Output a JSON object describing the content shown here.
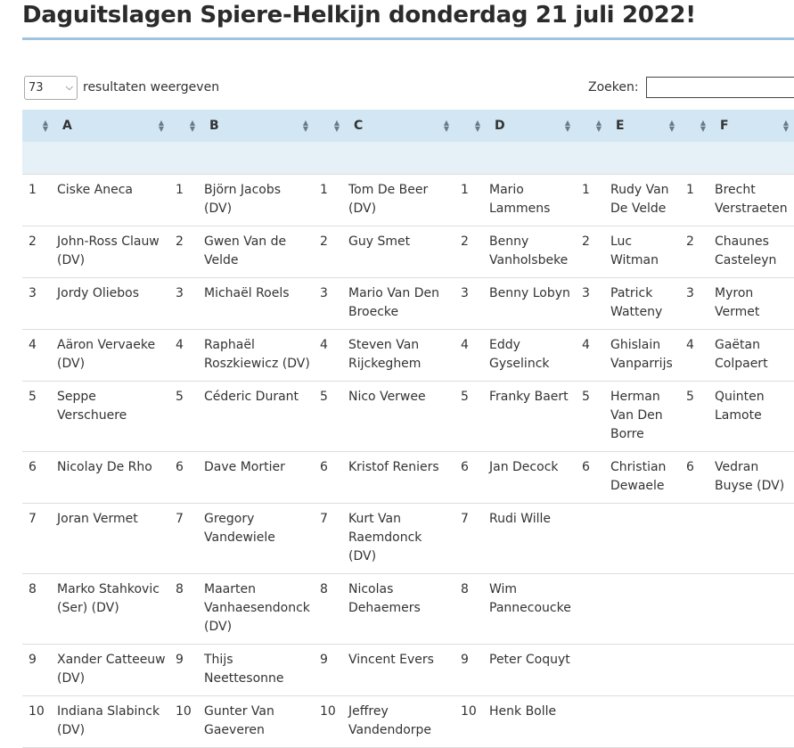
{
  "page": {
    "title": "Daguitslagen Spiere-Helkijn donderdag 21 juli 2022!"
  },
  "controls": {
    "length_value": "73",
    "length_label": "resultaten weergeven",
    "search_label": "Zoeken:",
    "search_value": ""
  },
  "table": {
    "columns": [
      "A",
      "B",
      "C",
      "D",
      "E",
      "F"
    ],
    "rows": [
      [
        [
          "1",
          "Ciske Aneca"
        ],
        [
          "1",
          "Björn Jacobs (DV)"
        ],
        [
          "1",
          "Tom De Beer (DV)"
        ],
        [
          "1",
          "Mario Lammens"
        ],
        [
          "1",
          "Rudy Van De Velde"
        ],
        [
          "1",
          "Brecht Verstraeten"
        ]
      ],
      [
        [
          "2",
          "John-Ross Clauw (DV)"
        ],
        [
          "2",
          "Gwen Van de Velde"
        ],
        [
          "2",
          "Guy Smet"
        ],
        [
          "2",
          "Benny Vanholsbeke"
        ],
        [
          "2",
          "Luc Witman"
        ],
        [
          "2",
          "Chaunes Casteleyn"
        ]
      ],
      [
        [
          "3",
          "Jordy Oliebos"
        ],
        [
          "3",
          "Michaël Roels"
        ],
        [
          "3",
          "Mario Van Den Broecke"
        ],
        [
          "3",
          "Benny Lobyn"
        ],
        [
          "3",
          "Patrick Watteny"
        ],
        [
          "3",
          "Myron Vermet"
        ]
      ],
      [
        [
          "4",
          "Aäron Vervaeke (DV)"
        ],
        [
          "4",
          "Raphaël Roszkiewicz (DV)"
        ],
        [
          "4",
          "Steven Van Rijckeghem"
        ],
        [
          "4",
          "Eddy Gyselinck"
        ],
        [
          "4",
          "Ghislain Vanparrijs"
        ],
        [
          "4",
          "Gaëtan Colpaert"
        ]
      ],
      [
        [
          "5",
          "Seppe Verschuere"
        ],
        [
          "5",
          "Céderic Durant"
        ],
        [
          "5",
          "Nico Verwee"
        ],
        [
          "5",
          "Franky Baert"
        ],
        [
          "5",
          "Herman Van Den Borre"
        ],
        [
          "5",
          "Quinten Lamote"
        ]
      ],
      [
        [
          "6",
          "Nicolay De Rho"
        ],
        [
          "6",
          "Dave Mortier"
        ],
        [
          "6",
          "Kristof Reniers"
        ],
        [
          "6",
          "Jan Decock"
        ],
        [
          "6",
          "Christian Dewaele"
        ],
        [
          "6",
          "Vedran Buyse (DV)"
        ]
      ],
      [
        [
          "7",
          "Joran Vermet"
        ],
        [
          "7",
          "Gregory Vandewiele"
        ],
        [
          "7",
          "Kurt Van Raemdonck (DV)"
        ],
        [
          "7",
          "Rudi Wille"
        ],
        [
          "",
          ""
        ],
        [
          "",
          ""
        ]
      ],
      [
        [
          "8",
          "Marko Stahkovic (Ser) (DV)"
        ],
        [
          "8",
          "Maarten Vanhaesendonck (DV)"
        ],
        [
          "8",
          "Nicolas Dehaemers"
        ],
        [
          "8",
          "Wim Pannecoucke"
        ],
        [
          "",
          ""
        ],
        [
          "",
          ""
        ]
      ],
      [
        [
          "9",
          "Xander Catteeuw (DV)"
        ],
        [
          "9",
          "Thijs Neettesonne"
        ],
        [
          "9",
          "Vincent Evers"
        ],
        [
          "9",
          "Peter Coquyt"
        ],
        [
          "",
          ""
        ],
        [
          "",
          ""
        ]
      ],
      [
        [
          "10",
          "Indiana Slabinck (DV)"
        ],
        [
          "10",
          "Gunter Van Gaeveren"
        ],
        [
          "10",
          "Jeffrey Vandendorpe"
        ],
        [
          "10",
          "Henk Bolle"
        ],
        [
          "",
          ""
        ],
        [
          "",
          ""
        ]
      ]
    ]
  }
}
